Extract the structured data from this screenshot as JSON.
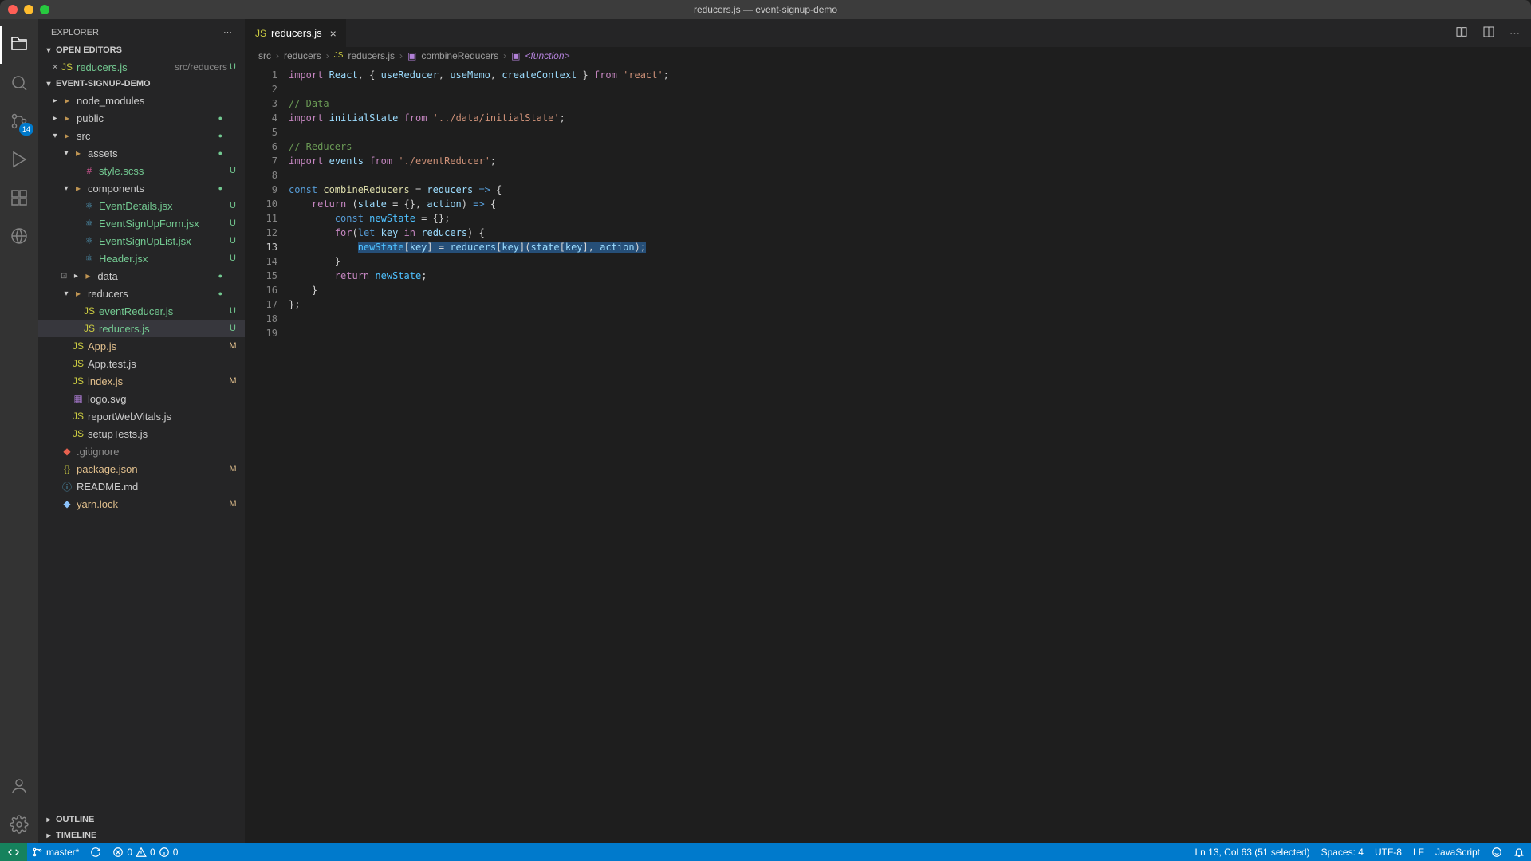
{
  "window": {
    "title": "reducers.js — event-signup-demo"
  },
  "sidebar": {
    "title": "EXPLORER",
    "sections": {
      "openEditors": {
        "label": "OPEN EDITORS",
        "items": [
          {
            "name": "reducers.js",
            "descr": "src/reducers",
            "status": "U"
          }
        ]
      },
      "project": {
        "label": "EVENT-SIGNUP-DEMO"
      },
      "outline": {
        "label": "OUTLINE"
      },
      "timeline": {
        "label": "TIMELINE"
      }
    },
    "tree": [
      {
        "depth": 0,
        "kind": "folder",
        "open": false,
        "label": "node_modules",
        "git": ""
      },
      {
        "depth": 0,
        "kind": "folder",
        "open": false,
        "label": "public",
        "git": "",
        "dot": true
      },
      {
        "depth": 0,
        "kind": "folder",
        "open": true,
        "label": "src",
        "git": "",
        "dot": true
      },
      {
        "depth": 1,
        "kind": "folder",
        "open": true,
        "label": "assets",
        "git": "",
        "dot": true
      },
      {
        "depth": 2,
        "kind": "file",
        "icon": "scss",
        "label": "style.scss",
        "git": "U"
      },
      {
        "depth": 1,
        "kind": "folder",
        "open": true,
        "label": "components",
        "git": "",
        "dot": true
      },
      {
        "depth": 2,
        "kind": "file",
        "icon": "jsx",
        "label": "EventDetails.jsx",
        "git": "U"
      },
      {
        "depth": 2,
        "kind": "file",
        "icon": "jsx",
        "label": "EventSignUpForm.jsx",
        "git": "U"
      },
      {
        "depth": 2,
        "kind": "file",
        "icon": "jsx",
        "label": "EventSignUpList.jsx",
        "git": "U"
      },
      {
        "depth": 2,
        "kind": "file",
        "icon": "jsx",
        "label": "Header.jsx",
        "git": "U"
      },
      {
        "depth": 1,
        "kind": "folder",
        "open": false,
        "label": "data",
        "git": "",
        "dot": true,
        "stash": true
      },
      {
        "depth": 1,
        "kind": "folder",
        "open": true,
        "label": "reducers",
        "git": "",
        "dot": true
      },
      {
        "depth": 2,
        "kind": "file",
        "icon": "js",
        "label": "eventReducer.js",
        "git": "U"
      },
      {
        "depth": 2,
        "kind": "file",
        "icon": "js",
        "label": "reducers.js",
        "git": "U",
        "selected": true
      },
      {
        "depth": 1,
        "kind": "file",
        "icon": "js",
        "label": "App.js",
        "git": "M"
      },
      {
        "depth": 1,
        "kind": "file",
        "icon": "js",
        "label": "App.test.js",
        "git": ""
      },
      {
        "depth": 1,
        "kind": "file",
        "icon": "js",
        "label": "index.js",
        "git": "M"
      },
      {
        "depth": 1,
        "kind": "file",
        "icon": "svg",
        "label": "logo.svg",
        "git": ""
      },
      {
        "depth": 1,
        "kind": "file",
        "icon": "js",
        "label": "reportWebVitals.js",
        "git": ""
      },
      {
        "depth": 1,
        "kind": "file",
        "icon": "js",
        "label": "setupTests.js",
        "git": ""
      },
      {
        "depth": 0,
        "kind": "file",
        "icon": "git",
        "label": ".gitignore",
        "git": "",
        "ignored": true
      },
      {
        "depth": 0,
        "kind": "file",
        "icon": "json",
        "label": "package.json",
        "git": "M"
      },
      {
        "depth": 0,
        "kind": "file",
        "icon": "md",
        "label": "README.md",
        "git": ""
      },
      {
        "depth": 0,
        "kind": "file",
        "icon": "yarn",
        "label": "yarn.lock",
        "git": "M"
      }
    ]
  },
  "activity": {
    "scm_badge": "14"
  },
  "tabs": [
    {
      "label": "reducers.js",
      "icon": "js"
    }
  ],
  "breadcrumb": {
    "parts": [
      "src",
      "reducers",
      "reducers.js"
    ],
    "symbol1": "combineReducers",
    "symbol2": "<function>"
  },
  "editor": {
    "highlight_line": 13,
    "lines": [
      {
        "n": 1,
        "html": "<span class='tok-kw'>import</span> <span class='tok-var'>React</span>, { <span class='tok-var'>useReducer</span>, <span class='tok-var'>useMemo</span>, <span class='tok-var'>createContext</span> } <span class='tok-kw'>from</span> <span class='tok-str'>'react'</span>;"
      },
      {
        "n": 2,
        "html": ""
      },
      {
        "n": 3,
        "html": "<span class='tok-com'>// Data</span>"
      },
      {
        "n": 4,
        "html": "<span class='tok-kw'>import</span> <span class='tok-var'>initialState</span> <span class='tok-kw'>from</span> <span class='tok-str'>'../data/initialState'</span>;"
      },
      {
        "n": 5,
        "html": ""
      },
      {
        "n": 6,
        "html": "<span class='tok-com'>// Reducers</span>"
      },
      {
        "n": 7,
        "html": "<span class='tok-kw'>import</span> <span class='tok-var'>events</span> <span class='tok-kw'>from</span> <span class='tok-str'>'./eventReducer'</span>;"
      },
      {
        "n": 8,
        "html": ""
      },
      {
        "n": 9,
        "html": "<span class='tok-kw2'>const</span> <span class='tok-fn'>combineReducers</span> = <span class='tok-var'>reducers</span> <span class='tok-kw2'>=&gt;</span> {"
      },
      {
        "n": 10,
        "html": "    <span class='tok-kw'>return</span> (<span class='tok-var'>state</span> = {}, <span class='tok-var'>action</span>) <span class='tok-kw2'>=&gt;</span> {"
      },
      {
        "n": 11,
        "html": "        <span class='tok-kw2'>const</span> <span class='tok-const'>newState</span> = {};"
      },
      {
        "n": 12,
        "html": "        <span class='tok-kw'>for</span>(<span class='tok-kw2'>let</span> <span class='tok-var'>key</span> <span class='tok-kw'>in</span> <span class='tok-var'>reducers</span>) {"
      },
      {
        "n": 13,
        "html": "            <span class='selected-code'><span class='tok-const'>newState</span>[<span class='tok-var'>key</span>] = <span class='tok-var'>reducers</span>[<span class='tok-var'>key</span>](<span class='tok-var'>state</span>[<span class='tok-var'>key</span>], <span class='tok-var'>action</span>);</span>"
      },
      {
        "n": 14,
        "html": "        }"
      },
      {
        "n": 15,
        "html": "        <span class='tok-kw'>return</span> <span class='tok-const'>newState</span>;"
      },
      {
        "n": 16,
        "html": "    }"
      },
      {
        "n": 17,
        "html": "};"
      },
      {
        "n": 18,
        "html": ""
      },
      {
        "n": 19,
        "html": ""
      }
    ]
  },
  "status": {
    "branch": "master*",
    "sync": "",
    "errors": "0",
    "warnings": "0",
    "info": "0",
    "cursor": "Ln 13, Col 63 (51 selected)",
    "spaces": "Spaces: 4",
    "encoding": "UTF-8",
    "eol": "LF",
    "language": "JavaScript"
  }
}
